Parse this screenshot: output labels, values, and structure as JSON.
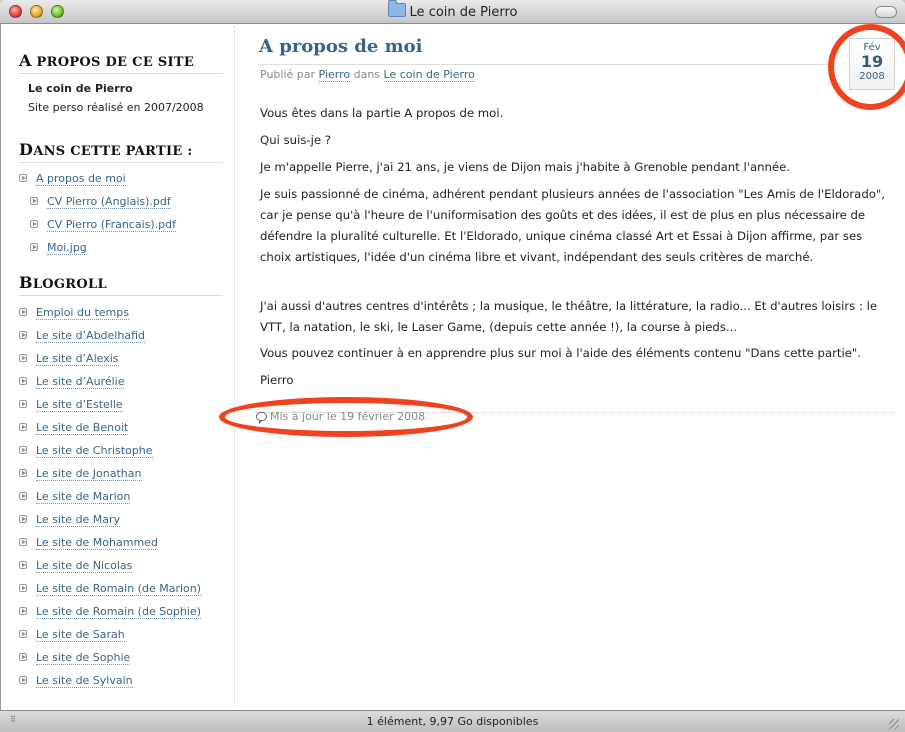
{
  "window": {
    "title": "Le coin de Pierro",
    "status": "1 élément, 9,97 Go disponibles"
  },
  "sidebar": {
    "about": {
      "heading_cap": "A",
      "heading_rest": " PROPOS DE CE SITE",
      "name": "Le coin de Pierro",
      "desc": "Site perso réalisé en 2007/2008"
    },
    "section": {
      "heading_cap": "D",
      "heading_rest": "ANS CETTE PARTIE :",
      "items": [
        {
          "label": "A propos de moi"
        },
        {
          "label": "CV Pierro (Anglais).pdf"
        },
        {
          "label": "CV Pierro (Francais).pdf"
        },
        {
          "label": "Moi.jpg"
        }
      ]
    },
    "blogroll": {
      "heading_cap": "B",
      "heading_rest": "LOGROLL",
      "items": [
        {
          "label": "Emploi du temps"
        },
        {
          "label": "Le site d’Abdelhafid"
        },
        {
          "label": "Le site d’Alexis"
        },
        {
          "label": "Le site d’Aurélie"
        },
        {
          "label": "Le site d’Estelle"
        },
        {
          "label": "Le site de Benoit"
        },
        {
          "label": "Le site de Christophe"
        },
        {
          "label": "Le site de Jonathan"
        },
        {
          "label": "Le site de Marion"
        },
        {
          "label": "Le site de Mary"
        },
        {
          "label": "Le site de Mohammed"
        },
        {
          "label": "Le site de Nicolas"
        },
        {
          "label": "Le site de Romain (de Marion)"
        },
        {
          "label": "Le site de Romain (de Sophie)"
        },
        {
          "label": "Le site de Sarah"
        },
        {
          "label": "Le site de Sophie"
        },
        {
          "label": "Le site de Sylvain"
        }
      ]
    }
  },
  "post": {
    "title": "A propos de moi",
    "meta": {
      "prefix": "Publié par",
      "author": "Pierro",
      "in": "dans",
      "category": "Le coin de Pierro"
    },
    "date": {
      "month": "Fév",
      "day": "19",
      "year": "2008"
    },
    "paragraphs": [
      "Vous êtes dans la partie A propos de moi.",
      "Qui suis-je ?",
      "Je m'appelle Pierre, j'ai 21 ans, je viens de Dijon mais j'habite à Grenoble pendant l'année.",
      "Je suis passionné de cinéma, adhérent pendant plusieurs années de l'association \"Les Amis de l'Eldorado\", car je pense qu'à l'heure de l'uniformisation des goûts et des idées, il est de plus en plus nécessaire de défendre la pluralité culturelle. Et l'Eldorado, unique cinéma classé Art et Essai à Dijon affirme, par ses choix artistiques, l'idée d'un cinéma libre et vivant, indépendant des seuls critères de marché.",
      "J'ai aussi d'autres centres d'intérêts ; la musique, le théâtre, la littérature, la radio... Et d'autres loisirs : le VTT, la natation, le ski, le Laser Game, (depuis cette année !), la course à pieds...",
      "Vous pouvez continuer à en apprendre plus sur moi à l'aide des éléments contenu \"Dans cette partie\".",
      "Pierro"
    ],
    "updated": "Mis à jour le 19 février 2008"
  }
}
